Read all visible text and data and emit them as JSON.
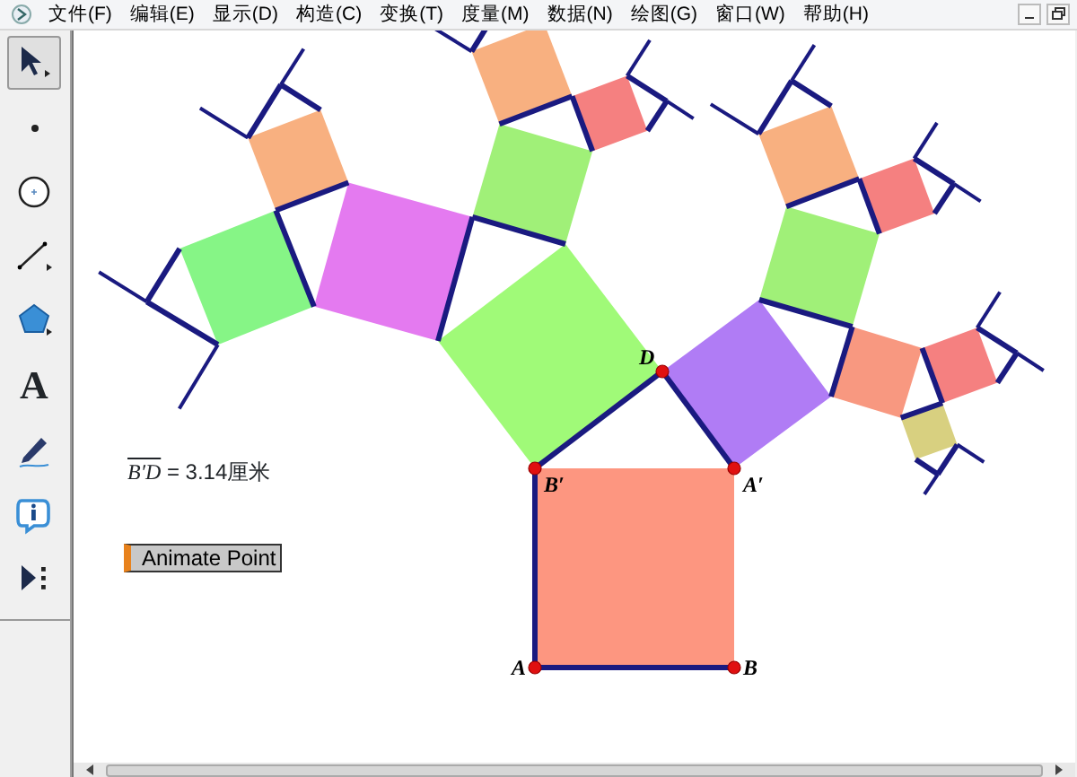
{
  "menu": [
    {
      "label": "文件(F)"
    },
    {
      "label": "编辑(E)"
    },
    {
      "label": "显示(D)"
    },
    {
      "label": "构造(C)"
    },
    {
      "label": "变换(T)"
    },
    {
      "label": "度量(M)"
    },
    {
      "label": "数据(N)"
    },
    {
      "label": "绘图(G)"
    },
    {
      "label": "窗口(W)"
    },
    {
      "label": "帮助(H)"
    }
  ],
  "tools": [
    {
      "kind": "arrow",
      "selected": true
    },
    {
      "kind": "point",
      "selected": false
    },
    {
      "kind": "compass",
      "selected": false
    },
    {
      "kind": "line",
      "selected": false
    },
    {
      "kind": "polygon",
      "selected": false
    },
    {
      "kind": "text",
      "label": "A",
      "selected": false
    },
    {
      "kind": "marker",
      "selected": false
    },
    {
      "kind": "info",
      "selected": false
    },
    {
      "kind": "custom",
      "selected": false
    }
  ],
  "points": [
    {
      "label": "A"
    },
    {
      "label": "B"
    },
    {
      "label": "A′"
    },
    {
      "label": "B′"
    },
    {
      "label": "D"
    }
  ],
  "measurement": {
    "segment": "B′D",
    "value": " = 3.14厘米"
  },
  "button": {
    "label": "Animate Point"
  }
}
